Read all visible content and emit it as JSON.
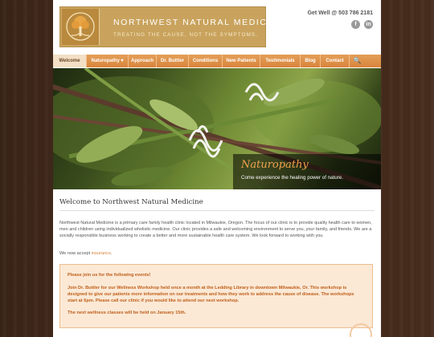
{
  "header": {
    "logo_title": "NORTHWEST NATURAL MEDICINE",
    "logo_tagline": "TREATING THE CAUSE, NOT THE SYMPTOMS.",
    "contact": "Get Well @ 503 786 2181",
    "social": [
      {
        "icon": "facebook-icon",
        "glyph": "f"
      },
      {
        "icon": "linkedin-icon",
        "glyph": "in"
      }
    ]
  },
  "nav": {
    "items": [
      {
        "label": "Welcome",
        "active": true
      },
      {
        "label": "Naturopathy ▾"
      },
      {
        "label": "Approach"
      },
      {
        "label": "Dr. Buttler"
      },
      {
        "label": "Conditions"
      },
      {
        "label": "New Patients"
      },
      {
        "label": "Testimonials"
      },
      {
        "label": "Blog"
      },
      {
        "label": "Contact"
      }
    ],
    "search_icon": "🔍"
  },
  "hero": {
    "caption_title": "Naturopathy",
    "caption_subtitle": "Come experience the healing power of nature."
  },
  "content": {
    "heading": "Welcome to Northwest Natural Medicine",
    "paragraph": "Northwest Natural Medicine is a primary care family health clinic located in Milwaukie, Oregon. The focus of our clinic is to provide quality health care to women, men and children using individualized wholistic medicine. Our clinic provides a safe and welcoming environment to serve you, your family, and friends. We are a socially responsible business working to create a better and more sustainable health care system. We look forward to working with you.",
    "accept_prefix": "We now accept ",
    "accept_link": "insurance",
    "accept_suffix": "."
  },
  "notice": {
    "line1": "Please join us for the following events!",
    "line2": "Join Dr. Buttler for our Wellness Workshop held once a month at the Ledding Library in downtown Milwaukie, Or. This workshop is designed to give our patients more information on our treatments and how they work to address the cause of disease. The workshops start at 6pm. Please call our clinic if you would like to attend our next workshop.",
    "line3": "The next wellness classes will be held on January 15th."
  },
  "colors": {
    "accent": "#d9843c",
    "logo_gold": "#c9a35d",
    "notice_bg": "#fbe9d6",
    "notice_text": "#c05f1a"
  }
}
